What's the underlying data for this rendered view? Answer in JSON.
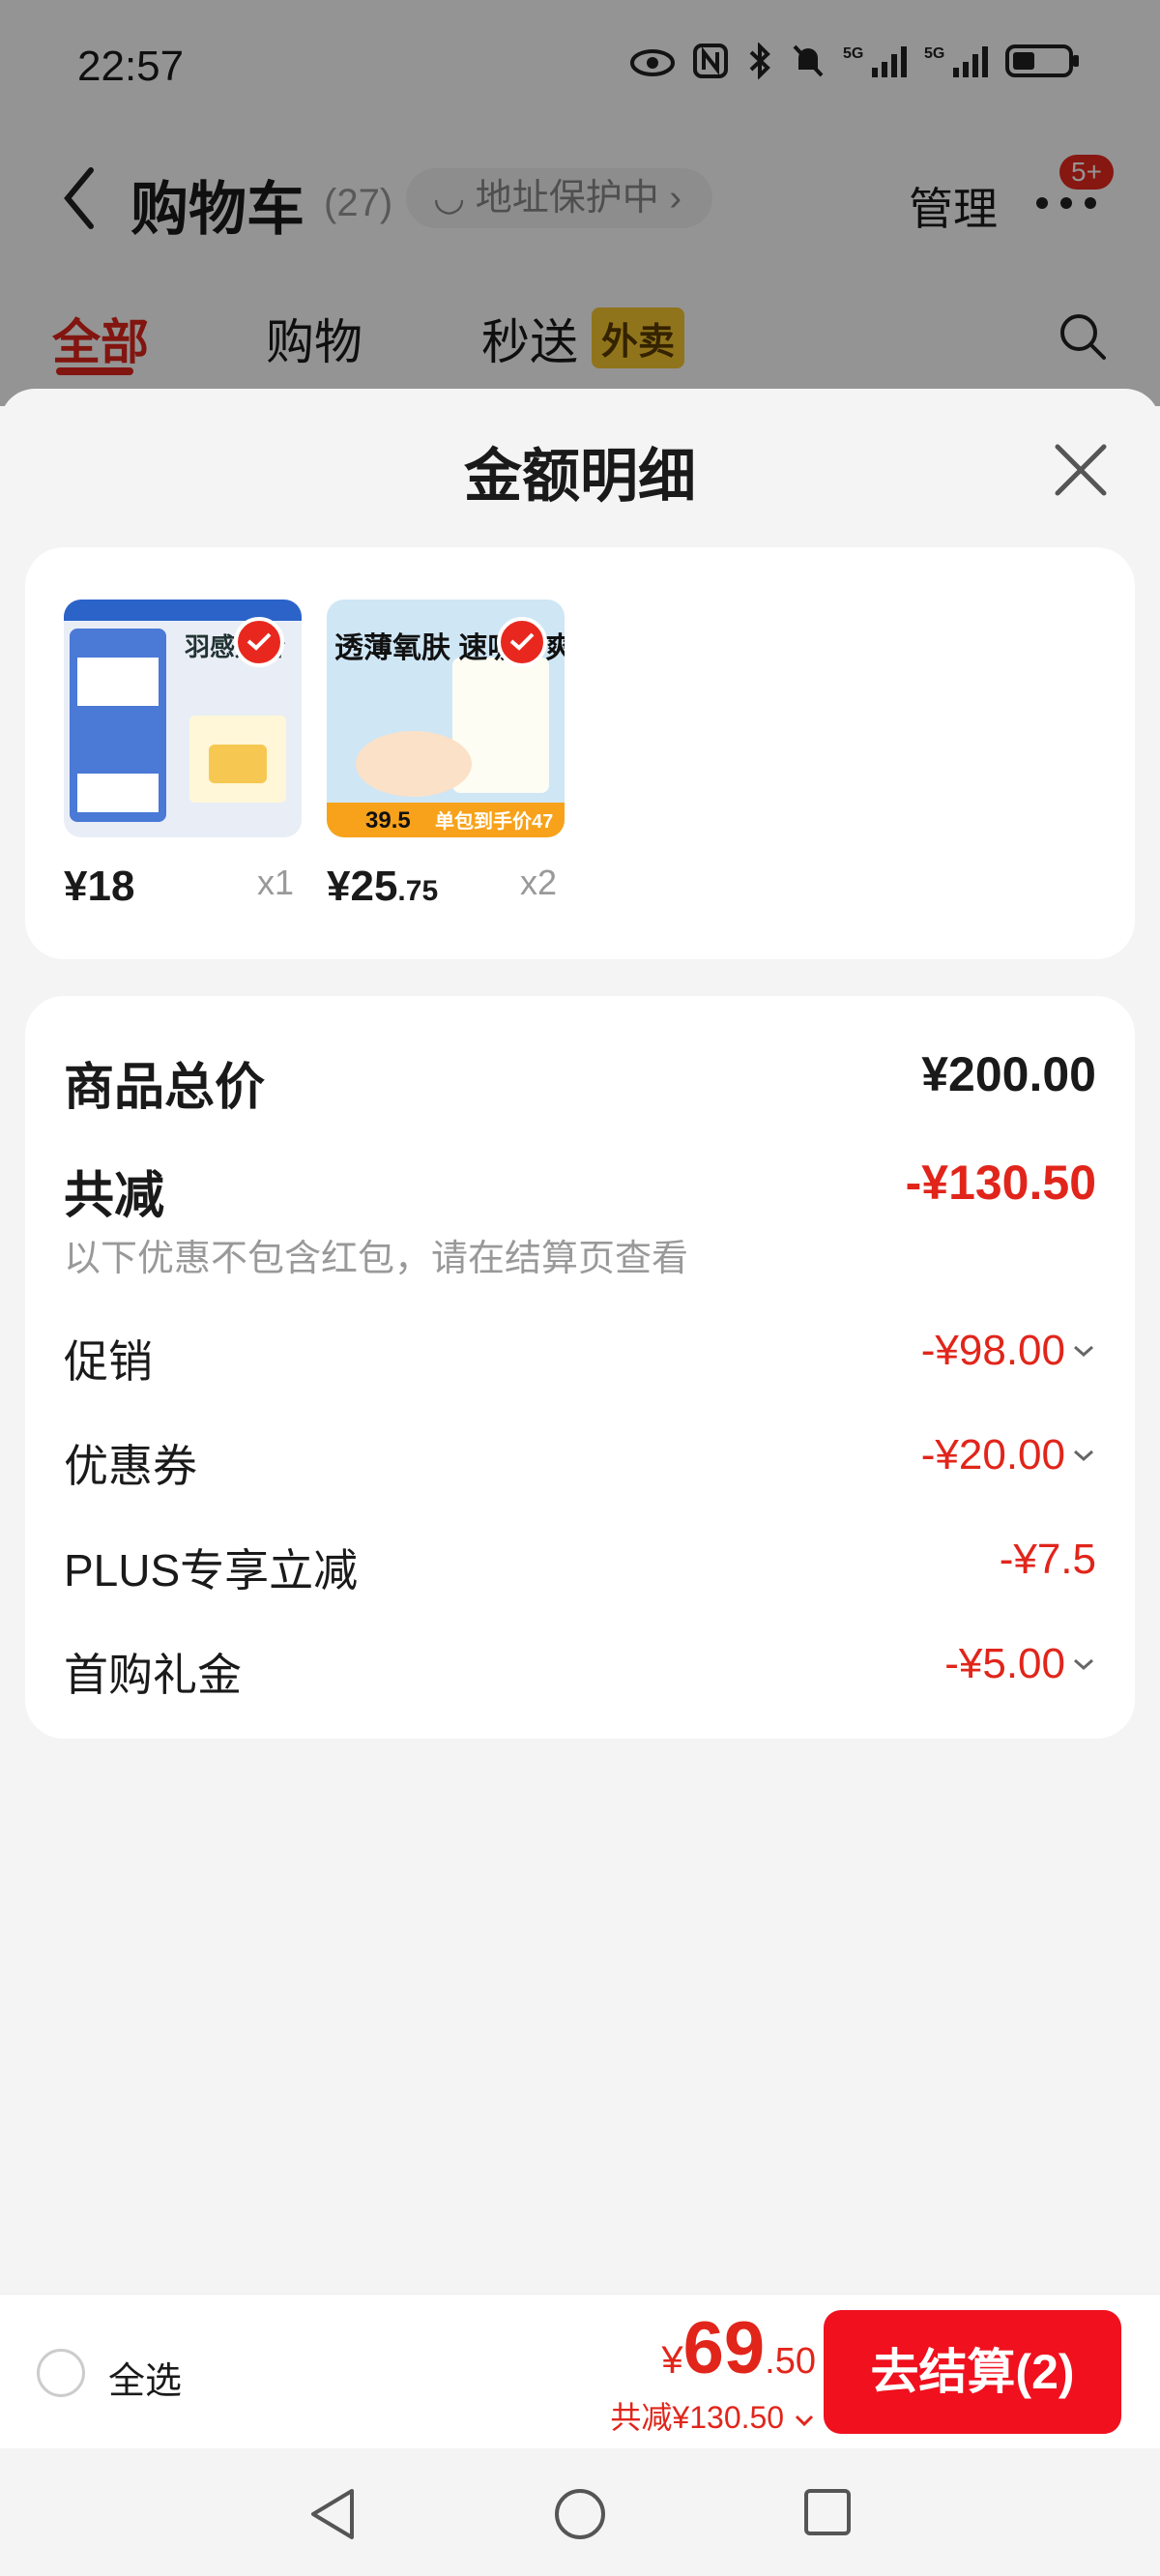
{
  "status": {
    "time": "22:57",
    "icons": [
      "eye-icon",
      "nfc-icon",
      "bluetooth-icon",
      "mute-icon",
      "5g-signal-icon",
      "5g-signal-icon",
      "battery-icon"
    ]
  },
  "header": {
    "title": "购物车",
    "count": "(27)",
    "address_protect": "地址保护中",
    "manage": "管理",
    "badge": "5+"
  },
  "tabs": [
    {
      "label": "全部",
      "active": true
    },
    {
      "label": "购物"
    },
    {
      "label": "秒送",
      "tag": "外卖"
    }
  ],
  "sheet": {
    "title": "金额明细",
    "products": [
      {
        "name": "羽感贴合",
        "price_int": "¥18",
        "price_dec": "",
        "qty": "x1",
        "selected": true
      },
      {
        "name": "透薄氧肤 速吸干爽",
        "price_int": "¥25",
        "price_dec": ".75",
        "qty": "x2",
        "selected": true,
        "promo_price": "39.5",
        "promo_text": "单包到手价47"
      }
    ],
    "summary": {
      "total_label": "商品总价",
      "total_value": "¥200.00",
      "reduce_label": "共减",
      "reduce_value": "-¥130.50",
      "note": "以下优惠不包含红包，请在结算页查看",
      "items": [
        {
          "label": "促销",
          "value": "-¥98.00",
          "expandable": true
        },
        {
          "label": "优惠券",
          "value": "-¥20.00",
          "expandable": true
        },
        {
          "label": "PLUS专享立减",
          "value": "-¥7.5",
          "expandable": false
        },
        {
          "label": "首购礼金",
          "value": "-¥5.00",
          "expandable": true
        }
      ]
    }
  },
  "bottom": {
    "select_all": "全选",
    "currency": "¥",
    "total_int": "69",
    "total_dec": ".50",
    "reduced": "共减¥130.50",
    "checkout": "去结算(2)"
  },
  "colors": {
    "accent": "#e1251b",
    "checkout": "#f0101e"
  }
}
